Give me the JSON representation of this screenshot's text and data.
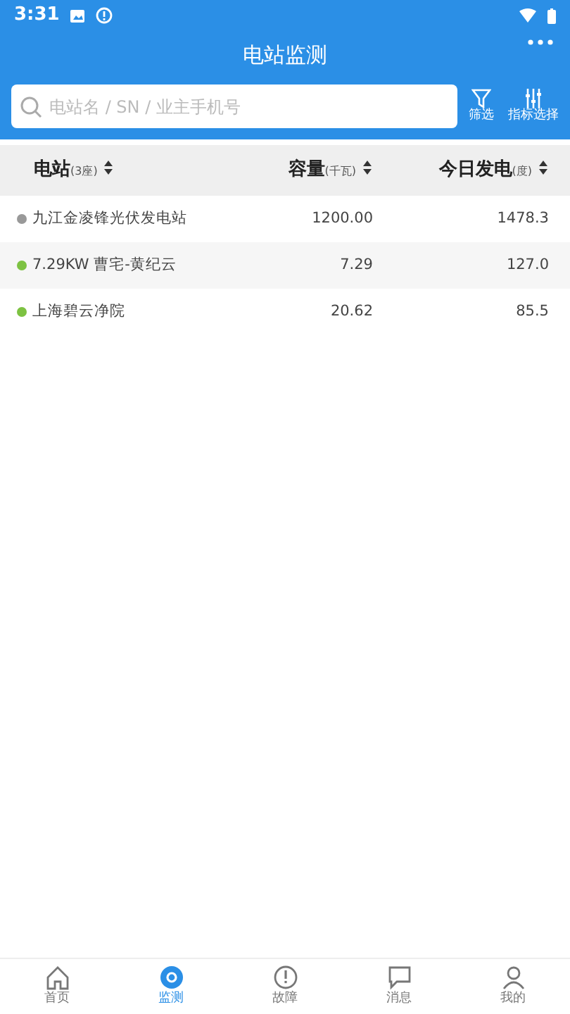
{
  "status_bar": {
    "time": "3:31"
  },
  "header": {
    "title": "电站监测"
  },
  "search": {
    "placeholder": "电站名 / SN / 业主手机号"
  },
  "actions": [
    {
      "kind": "filter",
      "label": "筛选"
    },
    {
      "kind": "metrics",
      "label": "指标选择"
    }
  ],
  "table": {
    "columns": [
      {
        "label": "电站",
        "unit": "(3座)"
      },
      {
        "label": "容量",
        "unit": "(千瓦)"
      },
      {
        "label": "今日发电",
        "unit": "(度)"
      }
    ],
    "rows": [
      {
        "name": "九江金凌锋光伏发电站",
        "color": "#999999",
        "capacity": "1200.00",
        "today": "1478.3"
      },
      {
        "name": "7.29KW 曹宅-黄纪云",
        "color": "#7dc242",
        "capacity": "7.29",
        "today": "127.0"
      },
      {
        "name": "上海碧云净院",
        "color": "#7dc242",
        "capacity": "20.62",
        "today": "85.5"
      }
    ]
  },
  "tab_bar": [
    {
      "kind": "home",
      "label": "首页",
      "selected": false
    },
    {
      "kind": "monitor",
      "label": "监测",
      "selected": true
    },
    {
      "kind": "fault",
      "label": "故障",
      "selected": false
    },
    {
      "kind": "message",
      "label": "消息",
      "selected": false
    },
    {
      "kind": "user",
      "label": "我的",
      "selected": false
    }
  ]
}
